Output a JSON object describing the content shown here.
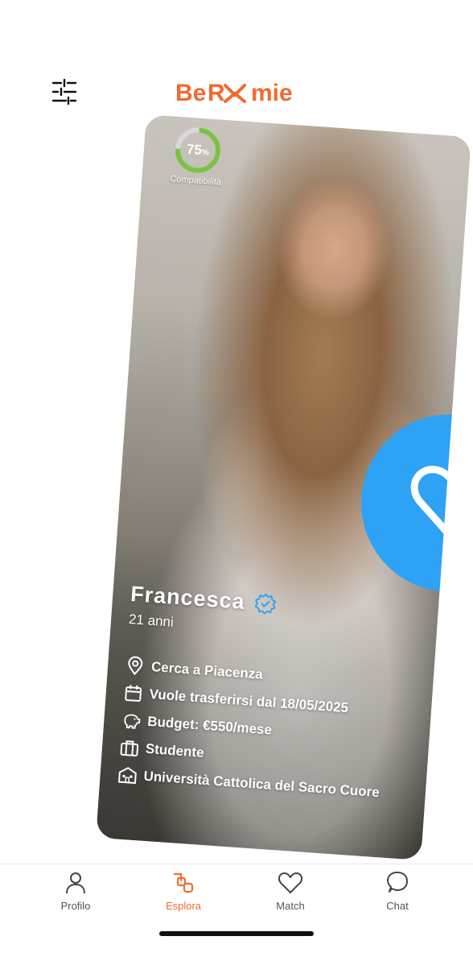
{
  "app": {
    "name": "BeRoomie",
    "brand_color": "#f26a2e",
    "accent_color": "#2ea2f5"
  },
  "header": {
    "logo_text": "BeRoomie",
    "filter_icon": "sliders-icon"
  },
  "profile": {
    "compatibility_value": "75",
    "compatibility_unit": "%",
    "compatibility_fraction": 0.75,
    "compatibility_label": "Compatibilità",
    "name": "Francesca",
    "verified_icon": "verified-badge-icon",
    "age": "21 anni",
    "details": [
      {
        "icon": "location-pin-icon",
        "text": "Cerca a Piacenza"
      },
      {
        "icon": "calendar-icon",
        "text": "Vuole trasferirsi dal 18/05/2025"
      },
      {
        "icon": "piggy-bank-icon",
        "text": "Budget: €550/mese"
      },
      {
        "icon": "briefcase-icon",
        "text": "Studente"
      },
      {
        "icon": "university-icon",
        "text": "Università Cattolica del Sacro Cuore"
      }
    ],
    "like_icon": "heart-icon"
  },
  "nav": {
    "items": [
      {
        "label": "Profilo",
        "icon": "person-icon",
        "active": false
      },
      {
        "label": "Esplora",
        "icon": "explore-icon",
        "active": true
      },
      {
        "label": "Match",
        "icon": "heart-icon",
        "active": false
      },
      {
        "label": "Chat",
        "icon": "chat-bubble-icon",
        "active": false
      }
    ]
  }
}
